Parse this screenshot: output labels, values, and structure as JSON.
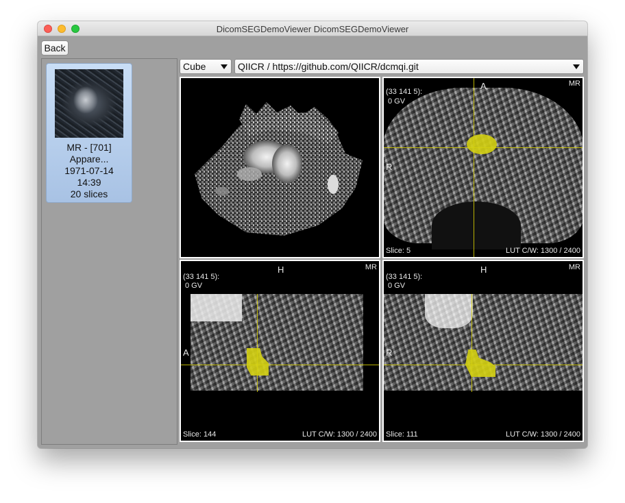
{
  "window": {
    "title": "DicomSEGDemoViewer DicomSEGDemoViewer"
  },
  "toolbar": {
    "back_label": "Back"
  },
  "series": {
    "modality_line": "MR - [701]",
    "description": "Appare...",
    "date": "1971-07-14",
    "time": "14:39",
    "slices": "20 slices"
  },
  "controls": {
    "render_mode": "Cube",
    "source_url": "QIICR / https://github.com/QIICR/dcmqi.git"
  },
  "views": {
    "axial": {
      "coords": "(33 141 5):",
      "value": "0 GV",
      "modality": "MR",
      "top_label": "A",
      "left_label": "R",
      "slice": "Slice: 5",
      "lut": "LUT C/W: 1300 / 2400"
    },
    "sagittal": {
      "coords": "(33 141 5):",
      "value": "0 GV",
      "modality": "MR",
      "top_label": "H",
      "left_label": "A",
      "slice": "Slice: 144",
      "lut": "LUT C/W: 1300 / 2400"
    },
    "coronal": {
      "coords": "(33 141 5):",
      "value": "0 GV",
      "modality": "MR",
      "top_label": "H",
      "left_label": "R",
      "slice": "Slice: 111",
      "lut": "LUT C/W: 1300 / 2400"
    }
  },
  "colors": {
    "segmentation": "#d4d012",
    "crosshair": "#d8d000",
    "selected_card": "#b8d0ee"
  }
}
